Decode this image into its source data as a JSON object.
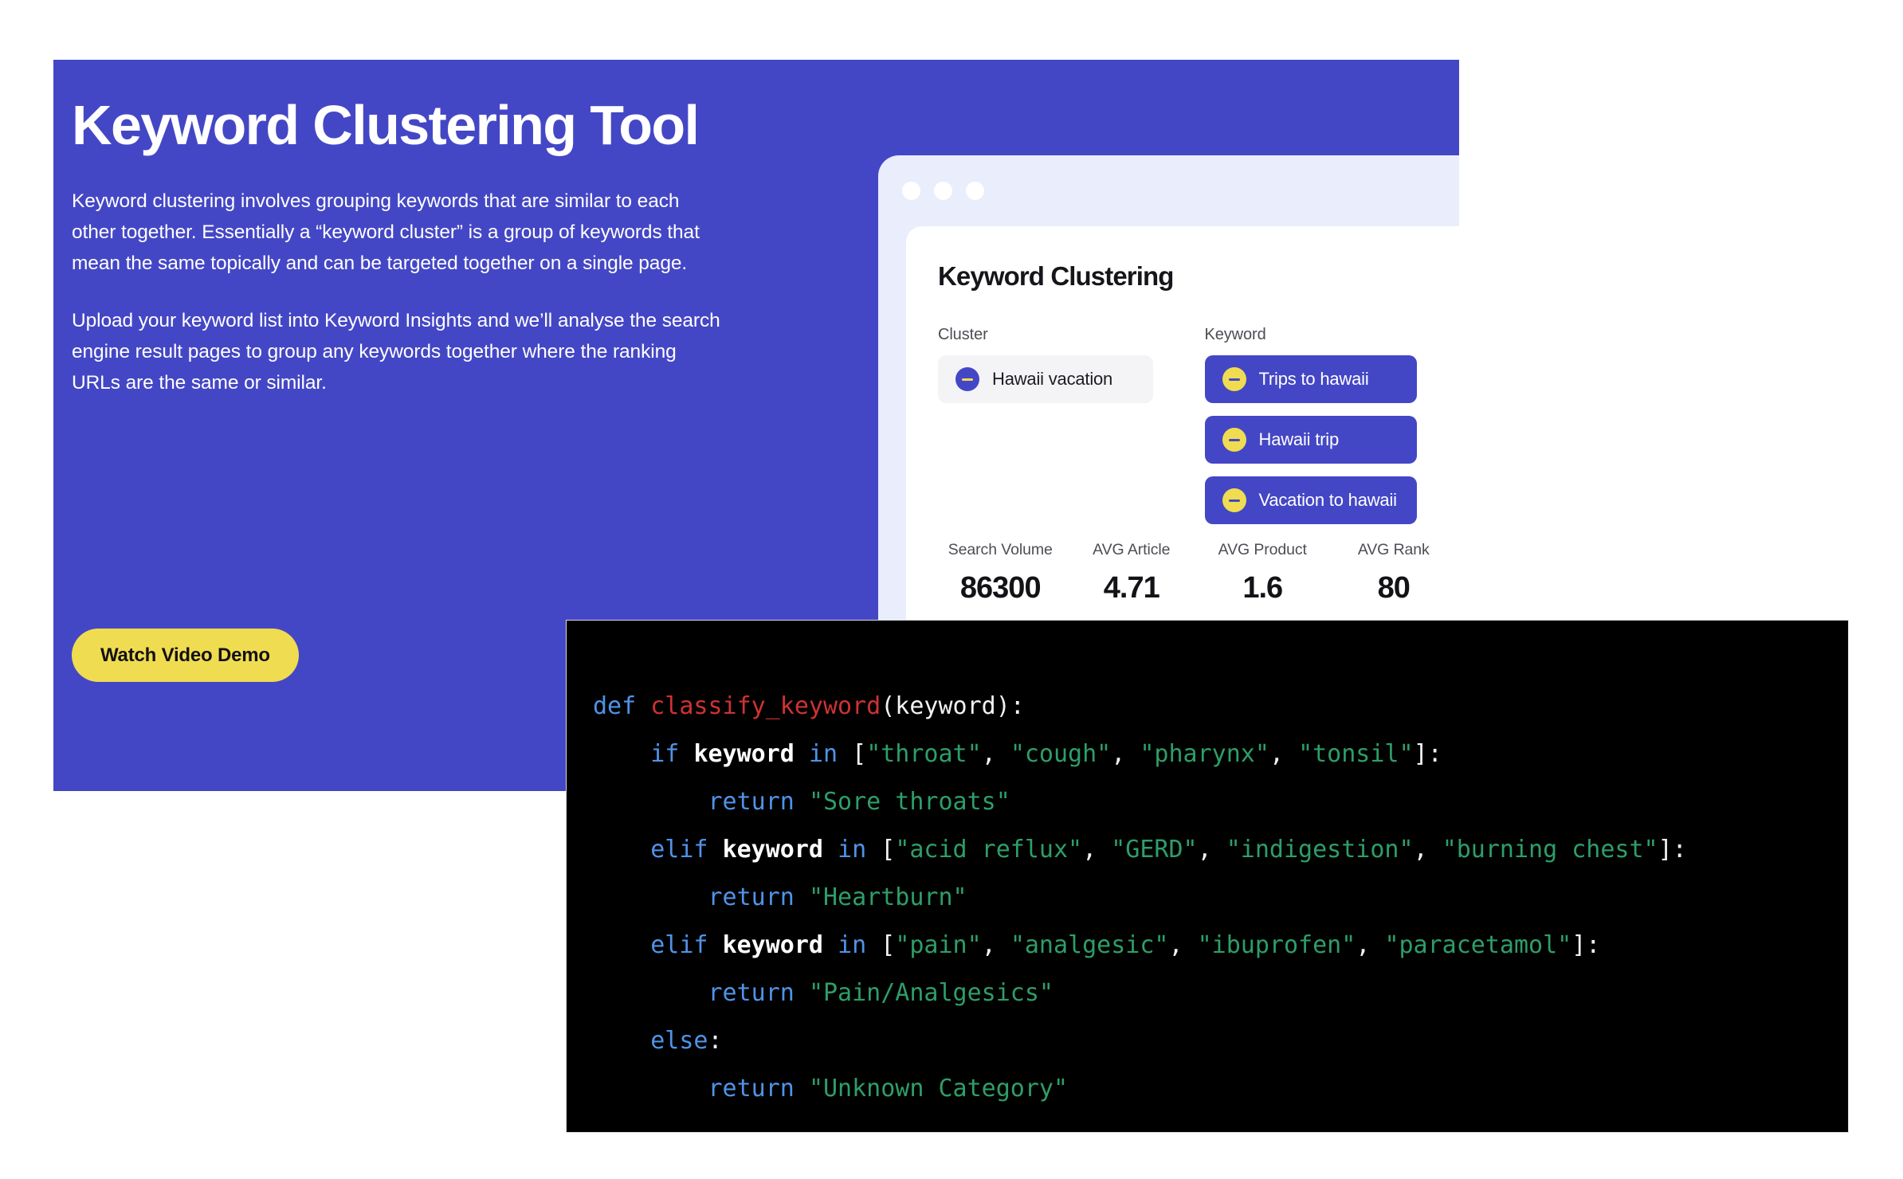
{
  "hero": {
    "title": "Keyword Clustering Tool",
    "paragraph_1": "Keyword clustering involves grouping keywords that are similar to each other together. Essentially a “keyword cluster” is a group of keywords that mean the same topically and can be targeted together on a single page.",
    "paragraph_2": "Upload your keyword list into Keyword Insights and we’ll analyse the search engine result pages to group any keywords together where the ranking URLs are the same or similar.",
    "cta_label": "Watch Video Demo",
    "background_color": "#4447C5",
    "cta_color": "#F0DC50"
  },
  "mockup": {
    "window_dots": [
      "dot-1",
      "dot-2",
      "dot-3"
    ],
    "card_title": "Keyword Clustering",
    "columns": {
      "cluster_label": "Cluster",
      "keyword_label": "Keyword"
    },
    "clusters": [
      {
        "label": "Hawaii vacation",
        "icon": "minus-icon"
      }
    ],
    "keywords": [
      {
        "label": "Trips to hawaii",
        "icon": "minus-icon"
      },
      {
        "label": "Hawaii trip",
        "icon": "minus-icon"
      },
      {
        "label": "Vacation to hawaii",
        "icon": "minus-icon"
      }
    ],
    "stats": [
      {
        "label": "Search Volume",
        "value": "86300"
      },
      {
        "label": "AVG Article",
        "value": "4.71"
      },
      {
        "label": "AVG Product",
        "value": "1.6"
      },
      {
        "label": "AVG Rank",
        "value": "80"
      }
    ]
  },
  "code": {
    "language": "python",
    "background_color": "#000000",
    "token_colors": {
      "keyword": "#4F93E8",
      "function": "#CF3232",
      "string": "#2E9E68",
      "plain": "#F2F2F2"
    },
    "lines": [
      [
        {
          "t": "def ",
          "c": "kw"
        },
        {
          "t": "classify_keyword",
          "c": "fn"
        },
        {
          "t": "(keyword):",
          "c": "pl"
        }
      ],
      [
        {
          "t": "    ",
          "c": "pl"
        },
        {
          "t": "if ",
          "c": "kw"
        },
        {
          "t": "keyword ",
          "c": "id"
        },
        {
          "t": "in ",
          "c": "kw"
        },
        {
          "t": "[",
          "c": "pl"
        },
        {
          "t": "\"throat\"",
          "c": "str"
        },
        {
          "t": ", ",
          "c": "pl"
        },
        {
          "t": "\"cough\"",
          "c": "str"
        },
        {
          "t": ", ",
          "c": "pl"
        },
        {
          "t": "\"pharynx\"",
          "c": "str"
        },
        {
          "t": ", ",
          "c": "pl"
        },
        {
          "t": "\"tonsil\"",
          "c": "str"
        },
        {
          "t": "]:",
          "c": "pl"
        }
      ],
      [
        {
          "t": "        ",
          "c": "pl"
        },
        {
          "t": "return ",
          "c": "kw"
        },
        {
          "t": "\"Sore throats\"",
          "c": "str"
        }
      ],
      [
        {
          "t": "    ",
          "c": "pl"
        },
        {
          "t": "elif ",
          "c": "kw"
        },
        {
          "t": "keyword ",
          "c": "id"
        },
        {
          "t": "in ",
          "c": "kw"
        },
        {
          "t": "[",
          "c": "pl"
        },
        {
          "t": "\"acid reflux\"",
          "c": "str"
        },
        {
          "t": ", ",
          "c": "pl"
        },
        {
          "t": "\"GERD\"",
          "c": "str"
        },
        {
          "t": ", ",
          "c": "pl"
        },
        {
          "t": "\"indigestion\"",
          "c": "str"
        },
        {
          "t": ", ",
          "c": "pl"
        },
        {
          "t": "\"burning chest\"",
          "c": "str"
        },
        {
          "t": "]:",
          "c": "pl"
        }
      ],
      [
        {
          "t": "        ",
          "c": "pl"
        },
        {
          "t": "return ",
          "c": "kw"
        },
        {
          "t": "\"Heartburn\"",
          "c": "str"
        }
      ],
      [
        {
          "t": "    ",
          "c": "pl"
        },
        {
          "t": "elif ",
          "c": "kw"
        },
        {
          "t": "keyword ",
          "c": "id"
        },
        {
          "t": "in ",
          "c": "kw"
        },
        {
          "t": "[",
          "c": "pl"
        },
        {
          "t": "\"pain\"",
          "c": "str"
        },
        {
          "t": ", ",
          "c": "pl"
        },
        {
          "t": "\"analgesic\"",
          "c": "str"
        },
        {
          "t": ", ",
          "c": "pl"
        },
        {
          "t": "\"ibuprofen\"",
          "c": "str"
        },
        {
          "t": ", ",
          "c": "pl"
        },
        {
          "t": "\"paracetamol\"",
          "c": "str"
        },
        {
          "t": "]:",
          "c": "pl"
        }
      ],
      [
        {
          "t": "        ",
          "c": "pl"
        },
        {
          "t": "return ",
          "c": "kw"
        },
        {
          "t": "\"Pain/Analgesics\"",
          "c": "str"
        }
      ],
      [
        {
          "t": "    ",
          "c": "pl"
        },
        {
          "t": "else",
          "c": "kw"
        },
        {
          "t": ":",
          "c": "pl"
        }
      ],
      [
        {
          "t": "        ",
          "c": "pl"
        },
        {
          "t": "return ",
          "c": "kw"
        },
        {
          "t": "\"Unknown Category\"",
          "c": "str"
        }
      ]
    ]
  }
}
